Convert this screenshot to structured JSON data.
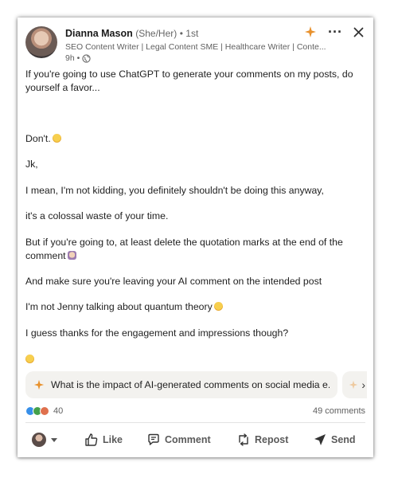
{
  "post": {
    "author_name": "Dianna Mason",
    "pronouns": "(She/Her)",
    "degree": "• 1st",
    "headline": "SEO Content Writer | Legal Content SME | Healthcare Writer | Conte...",
    "time": "9h •",
    "icons": {
      "premium": "sparkle-icon",
      "more": "more-options-icon",
      "close": "close-icon",
      "visibility": "globe-icon"
    },
    "body": [
      "If you're going to use ChatGPT to generate your comments on my posts, do yourself a favor...",
      "Don't.",
      "Jk,",
      "I mean, I'm not kidding, you definitely shouldn't be doing this anyway,",
      "it's a colossal waste of your time.",
      "But if you're going to, at least delete the quotation marks at the end of the comment",
      "And make sure you're leaving your AI comment on the intended post",
      "I'm not Jenny talking about quantum theory",
      "I guess thanks for the engagement and impressions though?"
    ]
  },
  "suggestion": {
    "text": "What is the impact of AI-generated comments on social media e...",
    "next_icon": "chevron-right-icon"
  },
  "social": {
    "reaction_count": "40",
    "comments": "49 comments"
  },
  "actions": {
    "like": "Like",
    "comment": "Comment",
    "repost": "Repost",
    "send": "Send"
  },
  "colors": {
    "accent_spark": "#e8912d",
    "like_blue": "#378fe9",
    "celebrate_green": "#44a04b",
    "love_red": "#df704d"
  }
}
